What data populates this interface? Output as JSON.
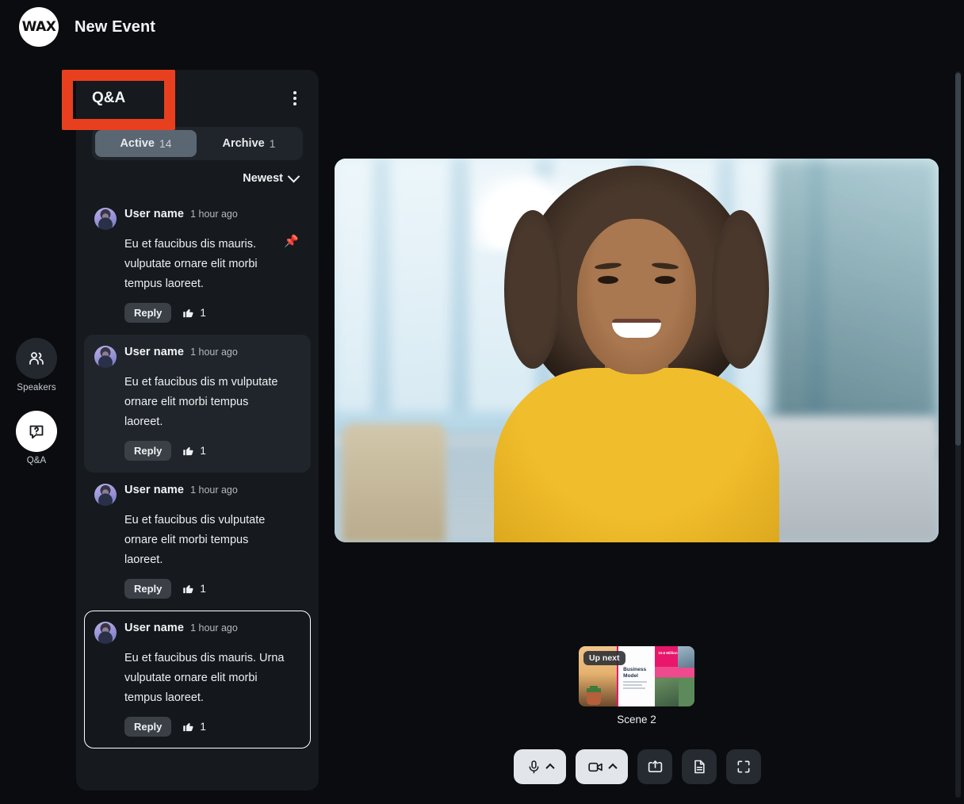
{
  "app": {
    "logo_text": "WAX",
    "event_title": "New Event",
    "background_color": "#0a0c0f",
    "accent_color": "#E8401F"
  },
  "rail": {
    "items": [
      {
        "label": "Speakers",
        "icon": "people-icon",
        "active": false
      },
      {
        "label": "Q&A",
        "icon": "question-bubble-icon",
        "active": true
      }
    ]
  },
  "qa_panel": {
    "title": "Q&A",
    "menu_icon": "more-vertical-icon",
    "tabs": [
      {
        "label": "Active",
        "count": "14",
        "active": true
      },
      {
        "label": "Archive",
        "count": "1",
        "active": false
      }
    ],
    "sort": {
      "label": "Newest",
      "icon": "chevron-down-icon"
    },
    "questions": [
      {
        "user": "User name",
        "time": "1 hour ago",
        "text": "Eu et faucibus dis mauris. vulputate ornare elit morbi tempus laoreet.",
        "reply_label": "Reply",
        "likes": "1",
        "pinned": true,
        "state": "default"
      },
      {
        "user": "User name",
        "time": "1 hour ago",
        "text": "Eu et faucibus dis m vulputate ornare elit morbi tempus laoreet.",
        "reply_label": "Reply",
        "likes": "1",
        "pinned": false,
        "state": "hover"
      },
      {
        "user": "User name",
        "time": "1 hour ago",
        "text": "Eu et faucibus dis vulputate ornare elit morbi tempus laoreet.",
        "reply_label": "Reply",
        "likes": "1",
        "pinned": false,
        "state": "default"
      },
      {
        "user": "User name",
        "time": "1 hour ago",
        "text": "Eu et faucibus dis mauris. Urna vulputate ornare elit morbi tempus laoreet.",
        "reply_label": "Reply",
        "likes": "1",
        "pinned": false,
        "state": "selected"
      }
    ]
  },
  "stage": {
    "video_alt": "Smiling woman with curly hair in a yellow t-shirt in a bright office",
    "scene": {
      "badge": "Up next",
      "label": "Scene 2",
      "slide_title": "Business Model",
      "slide_stat": "10.6 Million"
    }
  },
  "controls": [
    {
      "name": "microphone",
      "icon": "microphone-icon",
      "has_caret": true,
      "style": "light"
    },
    {
      "name": "camera",
      "icon": "video-camera-icon",
      "has_caret": true,
      "style": "light"
    },
    {
      "name": "share-screen",
      "icon": "share-screen-icon",
      "has_caret": false,
      "style": "dark"
    },
    {
      "name": "notes",
      "icon": "document-icon",
      "has_caret": false,
      "style": "dark"
    },
    {
      "name": "fullscreen",
      "icon": "fullscreen-icon",
      "has_caret": false,
      "style": "dark"
    }
  ]
}
